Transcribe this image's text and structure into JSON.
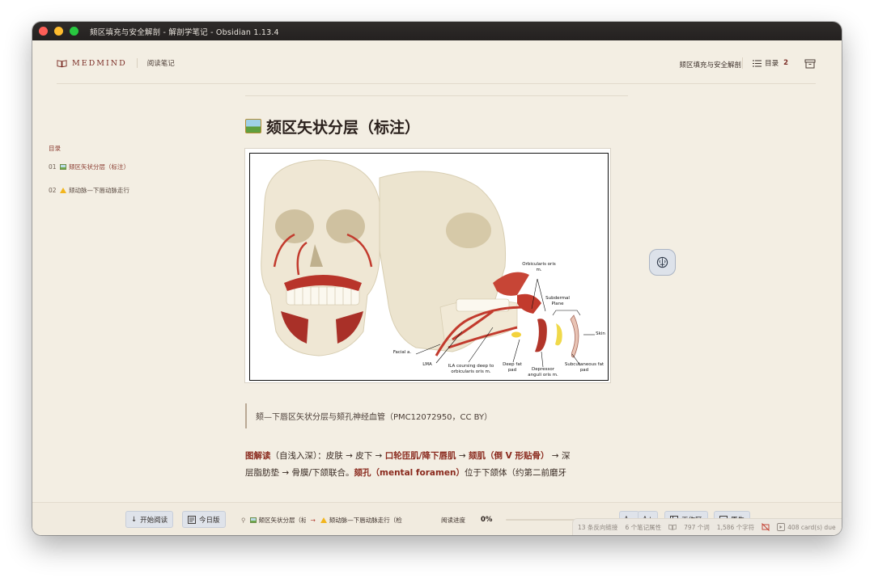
{
  "window": {
    "title": "颏区填充与安全解剖 - 解剖学笔记 - Obsidian 1.13.4"
  },
  "header": {
    "brand": "MEDMIND",
    "section": "阅读笔记",
    "doc_title": "颏区填充与安全解剖",
    "toc_label": "目录",
    "toc_count": "2"
  },
  "sidebar": {
    "label": "目录",
    "items": [
      {
        "num": "01",
        "icon": "framed-picture-icon",
        "text": "颏区矢状分层（标注）"
      },
      {
        "num": "02",
        "icon": "warning-icon",
        "text": "颏动脉—下唇动脉走行"
      }
    ]
  },
  "article": {
    "heading": "颏区矢状分层（标注）",
    "caption": "颏—下唇区矢状分层与颏孔神经血管（PMC12072950，CC BY）",
    "para": {
      "lead": "图解读",
      "p1": "（自浅入深）：皮肤 → 皮下 → ",
      "h1": "口轮匝肌/降下唇肌",
      "p2": " → ",
      "h2": "颏肌（倒 V 形贴骨）",
      "p3": " → 深",
      "line2a": "层脂肪垫 → 骨膜/下颌联合。",
      "h3": "颏孔（mental foramen）",
      "line2b": "位于下颌体（约第二前磨牙"
    },
    "figure_labels": {
      "orbicularis": "Orbicularis oris m.",
      "subdermal": "Subdermal Plane",
      "skin": "Skin",
      "facial": "Facial a.",
      "lma": "LMA",
      "ila": "ILA coursing deep to orbicularis oris m.",
      "deep_fat": "Deep fat pad",
      "depressor": "Depressor anguli oris m.",
      "subcutaneous": "Subcutaneous fat pad"
    }
  },
  "bottom_toolbar": {
    "start_reading": "开始阅读",
    "today": "今日版",
    "crumb1": "颏区矢状分层（标注）",
    "crumb2": "颏动脉—下唇动脉走行（检",
    "progress_label": "阅读进度",
    "progress_value": "0%",
    "progress_fraction": 0,
    "font_down": "A−",
    "font_up": "A+",
    "workspace": "工作区",
    "native": "原生"
  },
  "status_bar": {
    "backlinks": "13 条反向链接",
    "properties": "6 个笔记属性",
    "words": "797 个词",
    "chars": "1,586 个字符",
    "cards": "408 card(s) due"
  },
  "colors": {
    "accent": "#8a2a1e",
    "background": "#f3eee3",
    "titlebar": "#2a2725"
  }
}
